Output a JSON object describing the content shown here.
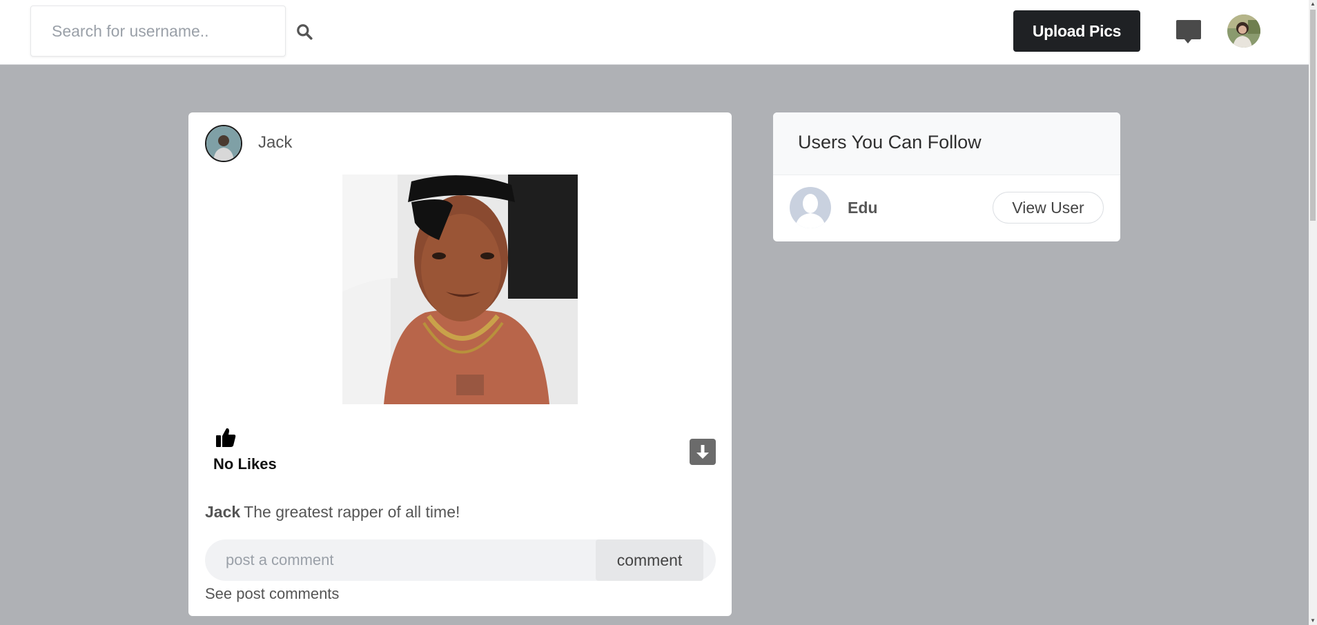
{
  "header": {
    "search": {
      "placeholder": "Search for username..",
      "value": ""
    },
    "upload_label": "Upload Pics",
    "icons": {
      "search": "search-icon",
      "messages": "chat-icon",
      "profile": "user-avatar"
    }
  },
  "post": {
    "username": "Jack",
    "likes_label": "No Likes",
    "caption_user": "Jack",
    "caption_text": "The greatest rapper of all time!",
    "comment_placeholder": "post a comment",
    "comment_value": "",
    "comment_button": "comment",
    "see_comments": "See post comments",
    "icons": {
      "like": "thumbs-up-icon",
      "download": "download-icon"
    }
  },
  "suggestions": {
    "title": "Users You Can Follow",
    "users": [
      {
        "name": "Edu",
        "action_label": "View User"
      }
    ]
  },
  "colors": {
    "page_bg": "#afb1b5",
    "topbar_bg": "#ffffff",
    "upload_button_bg": "#1f2124",
    "download_button_bg": "#6b6b6b"
  }
}
